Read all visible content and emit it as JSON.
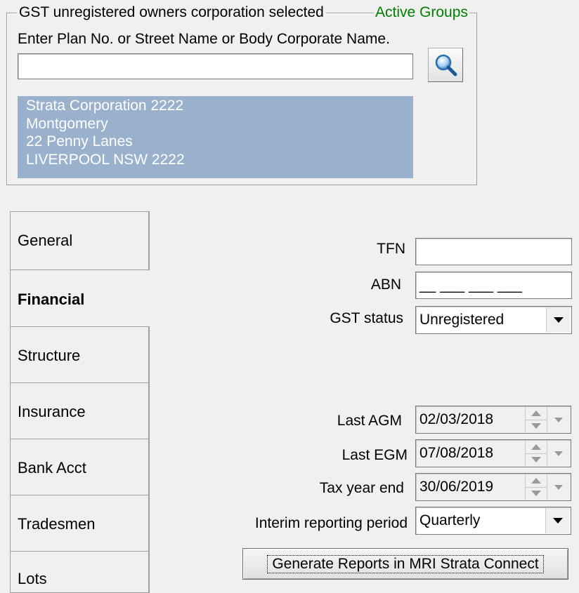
{
  "group": {
    "legend": "GST unregistered owners corporation selected",
    "active_groups": "Active Groups"
  },
  "search": {
    "label": "Enter Plan No. or Street Name or Body Corporate Name.",
    "value": "",
    "button_icon": "magnifier-icon"
  },
  "selected_address": [
    "Strata Corporation 2222",
    "Montgomery",
    "22 Penny Lanes",
    "LIVERPOOL  NSW  2222"
  ],
  "tabs": [
    {
      "label": "General",
      "active": false
    },
    {
      "label": "Financial",
      "active": true
    },
    {
      "label": "Structure",
      "active": false
    },
    {
      "label": "Insurance",
      "active": false
    },
    {
      "label": "Bank Acct",
      "active": false
    },
    {
      "label": "Tradesmen",
      "active": false
    },
    {
      "label": "Lots",
      "active": false
    }
  ],
  "financial": {
    "tfn_label": "TFN",
    "tfn_value": "",
    "abn_label": "ABN",
    "abn_mask": "__ ___ ___ ___",
    "gst_label": "GST status",
    "gst_value": "Unregistered",
    "last_agm_label": "Last AGM",
    "last_agm_value": "02/03/2018",
    "last_egm_label": "Last EGM",
    "last_egm_value": "07/08/2018",
    "tax_year_end_label": "Tax year end",
    "tax_year_end_value": "30/06/2019",
    "interim_label": "Interim reporting period",
    "interim_value": "Quarterly",
    "generate_button": "Generate Reports in MRI Strata Connect"
  },
  "colors": {
    "selection": "#9ab1ce",
    "active_groups": "#008000",
    "background": "#f0f0f0"
  }
}
